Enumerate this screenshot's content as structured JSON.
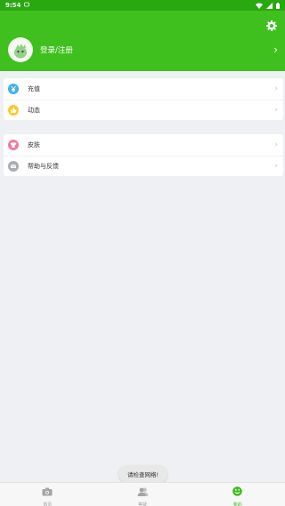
{
  "status_bar": {
    "time": "9:54"
  },
  "header": {
    "login_label": "登录/注册",
    "background_color": "#3fc01e"
  },
  "menu_groups": [
    {
      "items": [
        {
          "label": "充值",
          "icon": "recharge-yen-icon",
          "color": "#42aef0"
        },
        {
          "label": "动态",
          "icon": "thumbs-up-icon",
          "color": "#ffc72a"
        }
      ]
    },
    {
      "items": [
        {
          "label": "皮肤",
          "icon": "tshirt-icon",
          "color": "#f07b9f"
        },
        {
          "label": "帮助与反馈",
          "icon": "message-icon",
          "color": "#a9adb4"
        }
      ]
    }
  ],
  "toast": {
    "text": "请检查网络!"
  },
  "tabbar": {
    "tabs": [
      {
        "label": "首页",
        "icon": "camera-icon",
        "active": false
      },
      {
        "label": "答疑",
        "icon": "people-icon",
        "active": false
      },
      {
        "label": "我的",
        "icon": "smiley-icon",
        "active": true
      }
    ]
  }
}
